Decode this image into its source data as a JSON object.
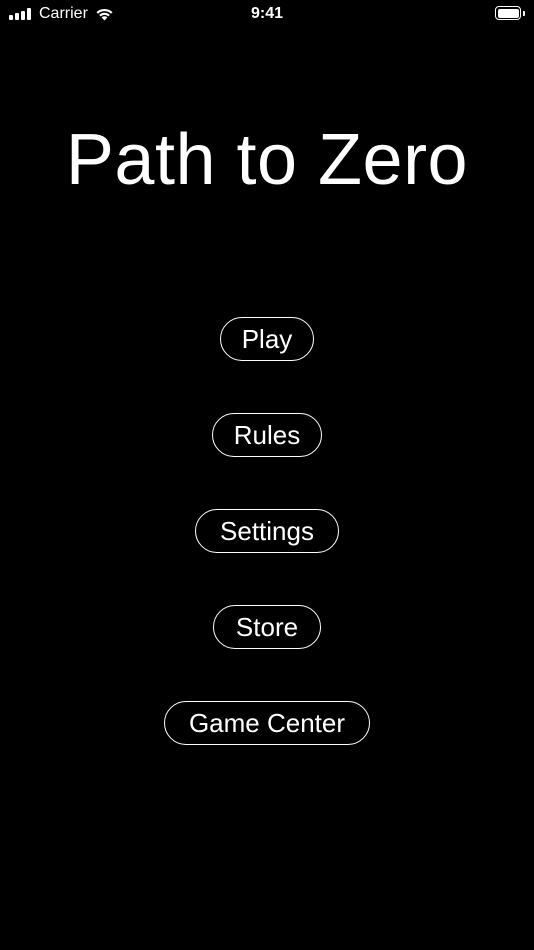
{
  "status_bar": {
    "carrier": "Carrier",
    "time": "9:41",
    "signal_icon": "cellular-signal-icon",
    "wifi_icon": "wifi-icon",
    "battery_icon": "battery-icon",
    "battery_level": 1.0
  },
  "title": "Path to Zero",
  "menu": {
    "play_label": "Play",
    "rules_label": "Rules",
    "settings_label": "Settings",
    "store_label": "Store",
    "game_center_label": "Game Center"
  },
  "colors": {
    "background": "#000000",
    "foreground": "#ffffff"
  }
}
